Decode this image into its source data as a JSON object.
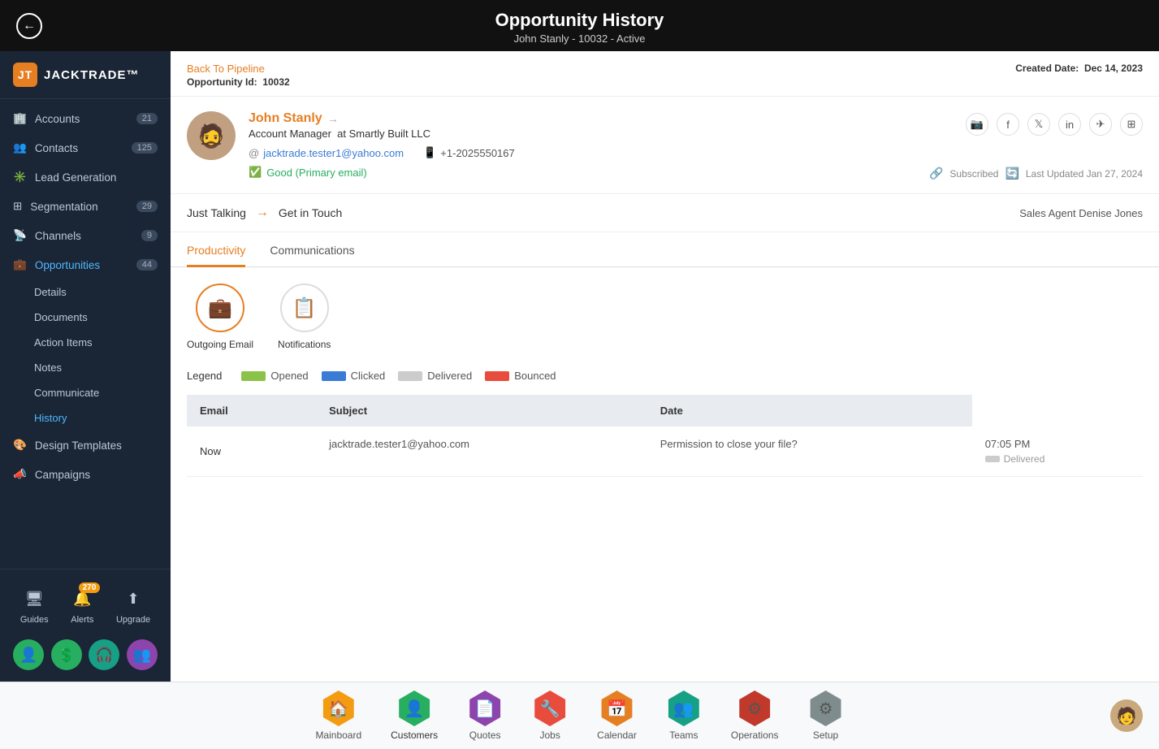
{
  "topBar": {
    "title": "Opportunity History",
    "subtitle": "John Stanly - 10032 - Active"
  },
  "sidebar": {
    "logo": "JACKTRADE™",
    "navItems": [
      {
        "id": "accounts",
        "label": "Accounts",
        "badge": "21",
        "icon": "🏢"
      },
      {
        "id": "contacts",
        "label": "Contacts",
        "badge": "125",
        "icon": "👥"
      },
      {
        "id": "lead-generation",
        "label": "Lead Generation",
        "badge": "",
        "icon": "✳️"
      },
      {
        "id": "segmentation",
        "label": "Segmentation",
        "badge": "29",
        "icon": "⊞"
      },
      {
        "id": "channels",
        "label": "Channels",
        "badge": "9",
        "icon": "📡"
      },
      {
        "id": "opportunities",
        "label": "Opportunities",
        "badge": "44",
        "icon": "💼",
        "active": true
      }
    ],
    "subNavItems": [
      {
        "id": "details",
        "label": "Details"
      },
      {
        "id": "documents",
        "label": "Documents"
      },
      {
        "id": "action-items",
        "label": "Action Items"
      },
      {
        "id": "notes",
        "label": "Notes"
      },
      {
        "id": "communicate",
        "label": "Communicate"
      },
      {
        "id": "history",
        "label": "History",
        "active": true
      }
    ],
    "bottomNavItems": [
      {
        "id": "design-templates",
        "label": "Design Templates",
        "icon": "🎨"
      },
      {
        "id": "campaigns",
        "label": "Campaigns",
        "icon": "📣"
      }
    ],
    "footerItems": [
      {
        "id": "guides",
        "label": "Guides",
        "icon": "🖥"
      },
      {
        "id": "alerts",
        "label": "Alerts",
        "icon": "🔔",
        "badge": "270"
      },
      {
        "id": "upgrade",
        "label": "Upgrade",
        "icon": "⬆"
      }
    ],
    "bottomIcons": [
      {
        "id": "person",
        "color": "#27ae60"
      },
      {
        "id": "dollar",
        "color": "#27ae60"
      },
      {
        "id": "headset",
        "color": "#16a085"
      },
      {
        "id": "group",
        "color": "#8e44ad"
      }
    ]
  },
  "header": {
    "backLink": "Back To Pipeline",
    "opportunityIdLabel": "Opportunity Id:",
    "opportunityIdValue": "10032",
    "createdDateLabel": "Created Date:",
    "createdDateValue": "Dec 14, 2023"
  },
  "person": {
    "name": "John Stanly",
    "role": "Account Manager",
    "company": "at Smartly Built LLC",
    "email": "jacktrade.tester1@yahoo.com",
    "phone": "+1-2025550167",
    "emailStatus": "Good (Primary email)",
    "subscribedLabel": "Subscribed",
    "lastUpdated": "Last Updated Jan 27, 2024"
  },
  "pipeline": {
    "currentStage": "Just Talking",
    "nextStage": "Get in Touch",
    "salesAgent": "Sales Agent Denise Jones"
  },
  "tabs": [
    {
      "id": "productivity",
      "label": "Productivity",
      "active": true
    },
    {
      "id": "communications",
      "label": "Communications"
    }
  ],
  "commIcons": [
    {
      "id": "outgoing-email",
      "label": "Outgoing Email",
      "icon": "💼",
      "primary": true
    },
    {
      "id": "notifications",
      "label": "Notifications",
      "icon": "📋",
      "primary": false
    }
  ],
  "legend": {
    "label": "Legend",
    "items": [
      {
        "id": "opened",
        "label": "Opened",
        "color": "#8bc34a"
      },
      {
        "id": "clicked",
        "label": "Clicked",
        "color": "#3a7bd5"
      },
      {
        "id": "delivered",
        "label": "Delivered",
        "color": "#ccc"
      },
      {
        "id": "bounced",
        "label": "Bounced",
        "color": "#e74c3c"
      }
    ]
  },
  "emailTable": {
    "columns": [
      "Email",
      "Subject",
      "Date"
    ],
    "rows": [
      {
        "timeLabel": "Now",
        "email": "jacktrade.tester1@yahoo.com",
        "subject": "Permission to close your file?",
        "time": "07:05 PM",
        "status": "Delivered"
      }
    ]
  },
  "bottomNav": {
    "items": [
      {
        "id": "mainboard",
        "label": "Mainboard",
        "colorClass": "hex-yellow",
        "icon": "⬡"
      },
      {
        "id": "customers",
        "label": "Customers",
        "colorClass": "hex-green",
        "icon": "👤",
        "active": true
      },
      {
        "id": "quotes",
        "label": "Quotes",
        "colorClass": "hex-purple",
        "icon": "📄"
      },
      {
        "id": "jobs",
        "label": "Jobs",
        "colorClass": "hex-red",
        "icon": "🔧"
      },
      {
        "id": "calendar",
        "label": "Calendar",
        "colorClass": "hex-orange",
        "icon": "📅"
      },
      {
        "id": "teams",
        "label": "Teams",
        "colorClass": "hex-teal",
        "icon": "👥"
      },
      {
        "id": "operations",
        "label": "Operations",
        "colorClass": "hex-dark",
        "icon": "⚙"
      },
      {
        "id": "setup",
        "label": "Setup",
        "colorClass": "hex-gray",
        "icon": "⚙"
      }
    ]
  }
}
